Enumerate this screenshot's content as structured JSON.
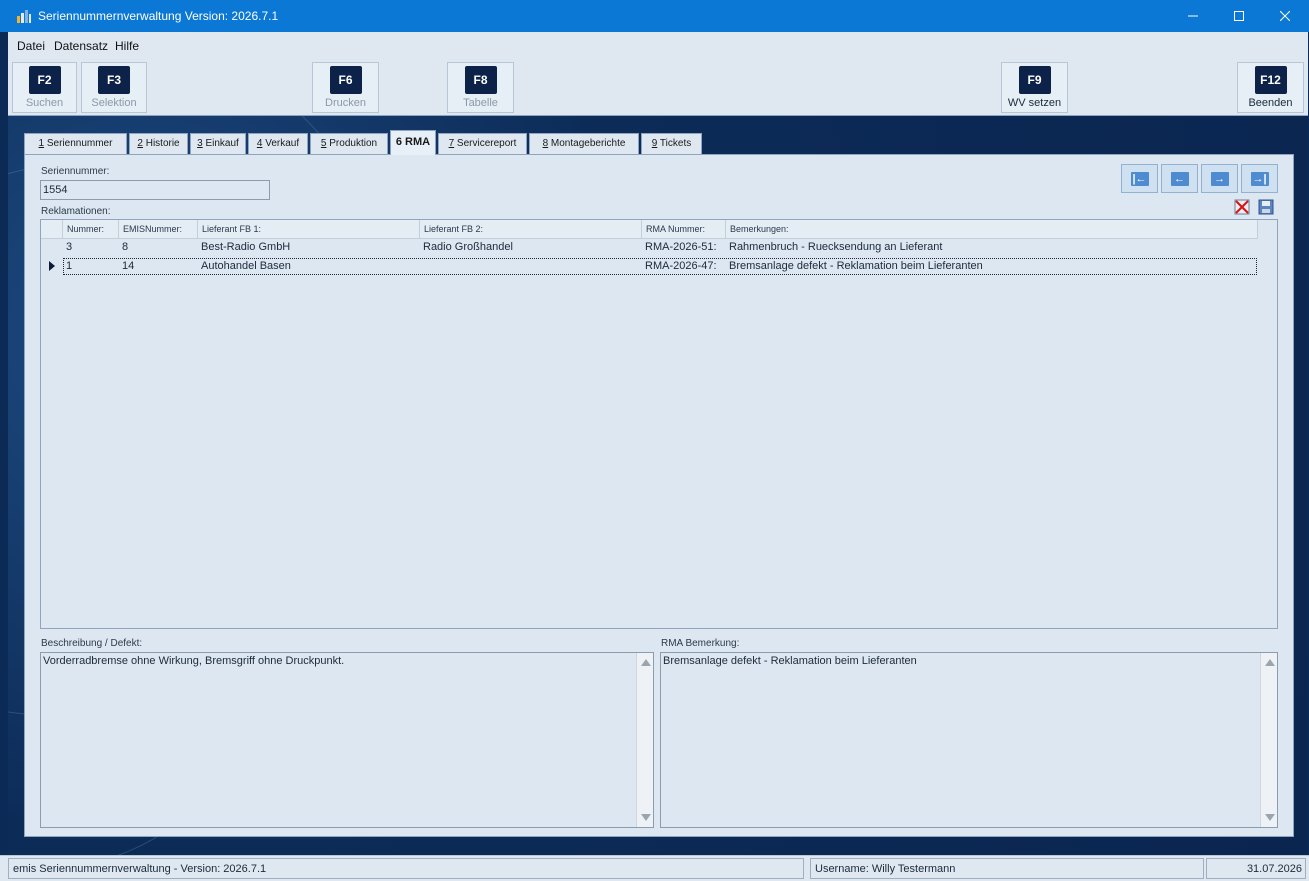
{
  "window": {
    "title": "Seriennummernverwaltung Version: 2026.7.1"
  },
  "menu": [
    {
      "label": "Datei"
    },
    {
      "label": "Datensatz"
    },
    {
      "label": "Hilfe"
    }
  ],
  "toolbar": [
    {
      "key": "F2",
      "label": "Suchen",
      "enabled": false
    },
    {
      "key": "F3",
      "label": "Selektion",
      "enabled": false
    },
    {
      "key": "F6",
      "label": "Drucken",
      "enabled": false
    },
    {
      "key": "F8",
      "label": "Tabelle",
      "enabled": false
    },
    {
      "key": "F9",
      "label": "WV setzen",
      "enabled": true
    },
    {
      "key": "F12",
      "label": "Beenden",
      "enabled": true
    }
  ],
  "tabs": [
    {
      "num": "1",
      "label": " Seriennummer"
    },
    {
      "num": "2",
      "label": " Historie"
    },
    {
      "num": "3",
      "label": " Einkauf"
    },
    {
      "num": "4",
      "label": " Verkauf"
    },
    {
      "num": "5",
      "label": " Produktion"
    },
    {
      "num": "6",
      "label": " RMA",
      "active": true
    },
    {
      "num": "7",
      "label": " Servicereport"
    },
    {
      "num": "8",
      "label": " Montageberichte"
    },
    {
      "num": "9",
      "label": " Tickets"
    }
  ],
  "form": {
    "serial_label": "Seriennummer:",
    "serial_value": "1554",
    "complaints_label": "Reklamationen:"
  },
  "grid": {
    "columns": [
      "Nummer:",
      "EMISNummer:",
      "Lieferant FB 1:",
      "Lieferant FB 2:",
      "RMA Nummer:",
      "Bemerkungen:"
    ],
    "rows": [
      [
        "3",
        "8",
        "Best-Radio GmbH",
        "Radio Großhandel",
        "RMA-2026-51:",
        "Rahmenbruch - Ruecksendung an Lieferant"
      ],
      [
        "1",
        "14",
        "Autohandel Basen",
        "",
        "RMA-2026-47:",
        "Bremsanlage defekt - Reklamation beim Lieferanten"
      ]
    ]
  },
  "memos": {
    "description_label": "Beschreibung / Defekt:",
    "description_value": "Vorderradbremse ohne Wirkung, Bremsgriff ohne Druckpunkt.",
    "rma_label": "RMA Bemerkung:",
    "rma_value": "Bremsanlage defekt - Reklamation beim Lieferanten"
  },
  "status": {
    "app": "emis Seriennummernverwaltung - Version: 2026.7.1",
    "user": "Username: Willy Testermann",
    "date": "31.07.2026"
  },
  "colors": {
    "titlebar": "#0a78d4",
    "panel": "#dde7f1",
    "background": "#0b2a55"
  }
}
